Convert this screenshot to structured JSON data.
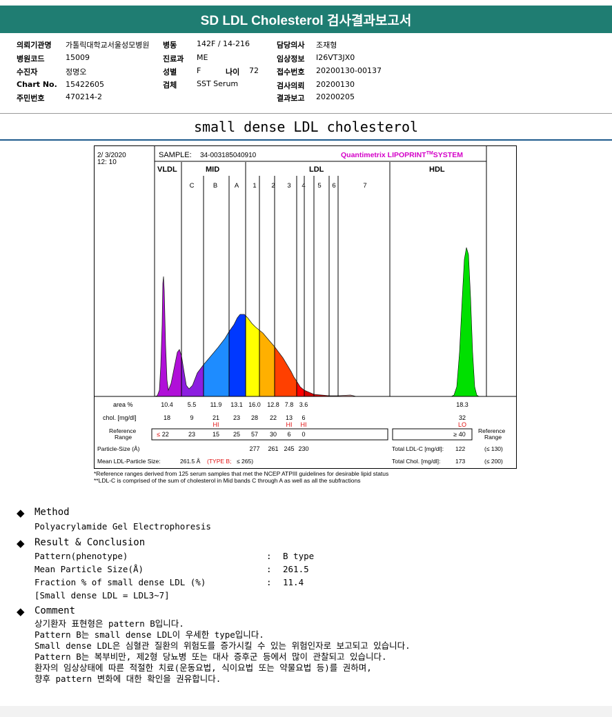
{
  "header": {
    "title": "SD LDL Cholesterol 검사결과보고서"
  },
  "patient": {
    "col1": [
      {
        "label": "의뢰기관명",
        "value": "가톨릭대학교서울성모병원"
      },
      {
        "label": "병원코드",
        "value": "15009"
      },
      {
        "label": "수진자",
        "value": "정명오"
      },
      {
        "label": "Chart No.",
        "value": "15422605"
      },
      {
        "label": "주민번호",
        "value": "470214-2"
      }
    ],
    "col2": [
      {
        "label": "병동",
        "value": "142F / 14-216"
      },
      {
        "label": "진료과",
        "value": "ME"
      },
      {
        "label": "성별",
        "value": "F"
      },
      {
        "label": "검체",
        "value": "SST Serum"
      }
    ],
    "age": {
      "label": "나이",
      "value": "72"
    },
    "col3": [
      {
        "label": "담당의사",
        "value": "조재형"
      },
      {
        "label": "임상정보",
        "value": "I26VT3JX0"
      },
      {
        "label": "접수번호",
        "value": "20200130-00137"
      },
      {
        "label": "검사의뢰",
        "value": "20200130"
      },
      {
        "label": "결과보고",
        "value": "20200205"
      }
    ]
  },
  "section_title": "small dense LDL cholesterol",
  "chart_data": {
    "type": "area",
    "date": "2/ 3/2020",
    "time": "12: 10",
    "sample_label": "SAMPLE:",
    "sample_id": "34-003185040910",
    "brand_prefix": "Quantimetrix LIPOPRINT",
    "brand_tm": "TM",
    "brand_suffix": "SYSTEM",
    "groups": [
      "VLDL",
      "MID",
      "LDL",
      "HDL"
    ],
    "bands": [
      "C",
      "B",
      "A",
      "1",
      "2",
      "3",
      "4",
      "5",
      "6",
      "7"
    ],
    "fractions": [
      "VLDL",
      "MID C",
      "MID B",
      "MID A",
      "LDL1",
      "LDL2",
      "LDL3",
      "LDL4",
      "LDL5",
      "LDL6",
      "LDL7",
      "HDL"
    ],
    "row_labels": {
      "area": "area %",
      "chol": "chol. [mg/dl]",
      "ref": "Reference Range",
      "ref_right": "Reference Range",
      "psize": "Particle-Size (Å)",
      "mean": "Mean LDL-Particle Size:"
    },
    "area_values": [
      "10.4",
      "5.5",
      "11.9",
      "13.1",
      "16.0",
      "12.8",
      "7.8",
      "3.6",
      "18.3"
    ],
    "chol_values": [
      "18",
      "9",
      "21",
      "23",
      "28",
      "22",
      "13",
      "6",
      "32"
    ],
    "flags": {
      "mid_b": "HI",
      "ldl3": "HI",
      "ldl4": "HI",
      "hdl": "LO"
    },
    "ref_values": [
      "≤ 22",
      "23",
      "15",
      "25",
      "57",
      "30",
      "6",
      "0",
      "≥ 40"
    ],
    "particle_sizes": [
      "277",
      "261",
      "245",
      "230"
    ],
    "mean_size": "261.5 Å",
    "mean_type": "(TYPE B;",
    "mean_type_ref": "≤ 265)",
    "total_ldl_label": "Total LDL-C [mg/dl]:",
    "total_ldl": "122",
    "total_ldl_ref": "(≤ 130)",
    "total_chol_label": "Total Chol. [mg/dl]:",
    "total_chol": "173",
    "total_chol_ref": "(≤ 200)",
    "colors": {
      "vldl": "#b010d8",
      "midc": "#8c1ee0",
      "midb": "#1e8cff",
      "mida": "#0038ff",
      "ldl1": "#ffff00",
      "ldl2": "#ffb000",
      "ldl3": "#ff4000",
      "ldl4": "#ff0000",
      "ldl5": "#d40000",
      "hdl": "#00e000"
    }
  },
  "notes": [
    "*Reference ranges derived from 125 serum samples that met the NCEP ATPIII guidelines for desirable lipid status",
    "**LDL-C is comprised of the sum of cholesterol in Mid bands C through A as well as all the subfractions"
  ],
  "method": {
    "heading": "Method",
    "text": "Polyacrylamide Gel Electrophoresis"
  },
  "result": {
    "heading": "Result & Conclusion",
    "rows": [
      {
        "label": "Pattern(phenotype)",
        "colon": ":",
        "value": "B type"
      },
      {
        "label": "Mean Particle Size(Å)",
        "colon": ":",
        "value": "261.5"
      },
      {
        "label": "Fraction % of small dense LDL (%)",
        "colon": ":",
        "value": "11.4"
      }
    ],
    "note": "[Small dense LDL = LDL3~7]"
  },
  "comment": {
    "heading": "Comment",
    "lines": [
      "상기환자 표현형은 pattern B입니다.",
      "Pattern B는 small dense LDL이 우세한 type입니다.",
      "Small dense LDL은 심혈관 질환의 위험도를 증가시킬 수 있는 위험인자로 보고되고 있습니다.",
      "Pattern B는 복부비만, 제2형 당뇨병 또는 대사 증후군 등에서 많이 관찰되고 있습니다.",
      "환자의 임상상태에 따른 적절한 치료(운동요법, 식이요법 또는 약물요법 등)를 권하며,",
      "향후 pattern 변화에 대한 확인을 권유합니다."
    ]
  }
}
